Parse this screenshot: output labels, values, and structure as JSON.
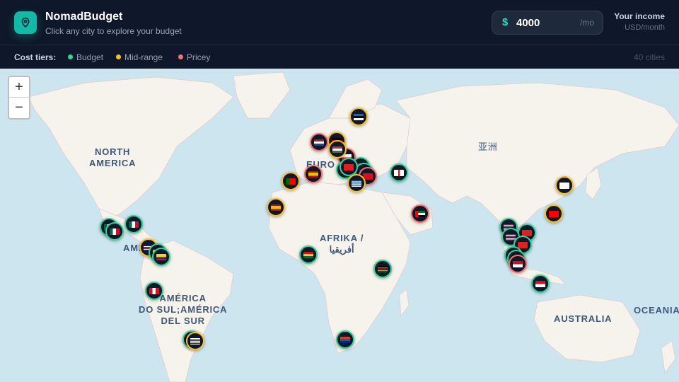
{
  "app": {
    "title": "NomadBudget",
    "subtitle": "Click any city to explore your budget"
  },
  "income": {
    "currency_symbol": "$",
    "value": "4000",
    "per": "/mo",
    "label": "Your income",
    "unit": "USD/month"
  },
  "tiers": {
    "label": "Cost tiers:",
    "items": [
      {
        "name": "Budget",
        "color": "#34d399"
      },
      {
        "name": "Mid-range",
        "color": "#fbbf24"
      },
      {
        "name": "Pricey",
        "color": "#f87171"
      }
    ],
    "count": "40 cities"
  },
  "map": {
    "labels": {
      "north_america": "NORTH\nAMERICA",
      "south_america": "AMÉRICA\nDO SUL;AMÉRICA\nDEL SUR",
      "europe": "EURO",
      "africa": "AFRIKA /\nأفريقيا",
      "asia": "亚洲",
      "australia": "AUSTRALIA",
      "oceania": "OCEANIA",
      "america_partial": "AMER"
    },
    "zoom_in": "+",
    "zoom_out": "−"
  },
  "markers": [
    {
      "flag": "Estonia",
      "tier": "mid"
    },
    {
      "flag": "Netherlands",
      "tier": "pricey"
    },
    {
      "flag": "Germany",
      "tier": "mid"
    },
    {
      "flag": "Czech Republic",
      "tier": "pricey"
    },
    {
      "flag": "Hungary",
      "tier": "mid"
    },
    {
      "flag": "Austria",
      "tier": "budget"
    },
    {
      "flag": "Romania",
      "tier": "budget"
    },
    {
      "flag": "Montenegro",
      "tier": "budget"
    },
    {
      "flag": "Albania",
      "tier": "budget"
    },
    {
      "flag": "Turkey",
      "tier": "pricey"
    },
    {
      "flag": "Spain",
      "tier": "pricey"
    },
    {
      "flag": "Portugal",
      "tier": "mid"
    },
    {
      "flag": "Greece",
      "tier": "mid"
    },
    {
      "flag": "Georgia",
      "tier": "budget"
    },
    {
      "flag": "Canary Islands",
      "tier": "mid"
    },
    {
      "flag": "UAE",
      "tier": "pricey"
    },
    {
      "flag": "Mexico",
      "tier": "budget"
    },
    {
      "flag": "Mexico",
      "tier": "budget"
    },
    {
      "flag": "Mexico",
      "tier": "budget"
    },
    {
      "flag": "Costa Rica",
      "tier": "mid"
    },
    {
      "flag": "Colombia",
      "tier": "budget"
    },
    {
      "flag": "Colombia",
      "tier": "budget"
    },
    {
      "flag": "Peru",
      "tier": "budget"
    },
    {
      "flag": "Argentina",
      "tier": "budget"
    },
    {
      "flag": "Uruguay",
      "tier": "mid"
    },
    {
      "flag": "Ghana",
      "tier": "budget"
    },
    {
      "flag": "Kenya",
      "tier": "budget"
    },
    {
      "flag": "South Africa",
      "tier": "budget"
    },
    {
      "flag": "South Korea",
      "tier": "mid"
    },
    {
      "flag": "Taiwan",
      "tier": "mid"
    },
    {
      "flag": "Thailand",
      "tier": "budget"
    },
    {
      "flag": "Thailand",
      "tier": "budget"
    },
    {
      "flag": "Vietnam",
      "tier": "budget"
    },
    {
      "flag": "Vietnam",
      "tier": "budget"
    },
    {
      "flag": "Malaysia",
      "tier": "budget"
    },
    {
      "flag": "Malaysia",
      "tier": "budget"
    },
    {
      "flag": "Indonesia",
      "tier": "pricey"
    },
    {
      "flag": "Indonesia",
      "tier": "budget"
    }
  ]
}
